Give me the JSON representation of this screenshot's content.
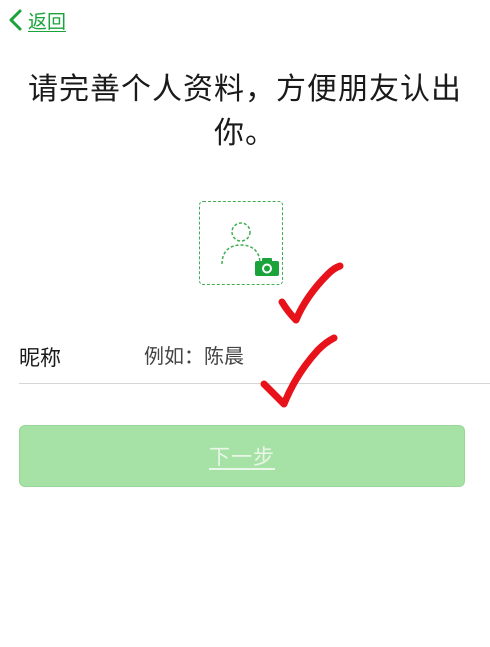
{
  "nav": {
    "back_label": "返回",
    "back_icon": "chevron-left-icon"
  },
  "heading": {
    "text": "请完善个人资料，方便朋友认出你。"
  },
  "avatar": {
    "placeholder_icon": "person-outline-icon",
    "upload_icon": "camera-icon"
  },
  "nickname": {
    "label": "昵称",
    "placeholder": "例如：陈晨",
    "value": ""
  },
  "next_button": {
    "label": "下一步",
    "enabled": false
  },
  "annotations": {
    "marks": [
      "red-checkmark",
      "red-checkmark"
    ]
  },
  "colors": {
    "accent_green": "#19a33a",
    "button_disabled_bg": "#a6e1a5",
    "annotation_red": "#e8121a"
  }
}
